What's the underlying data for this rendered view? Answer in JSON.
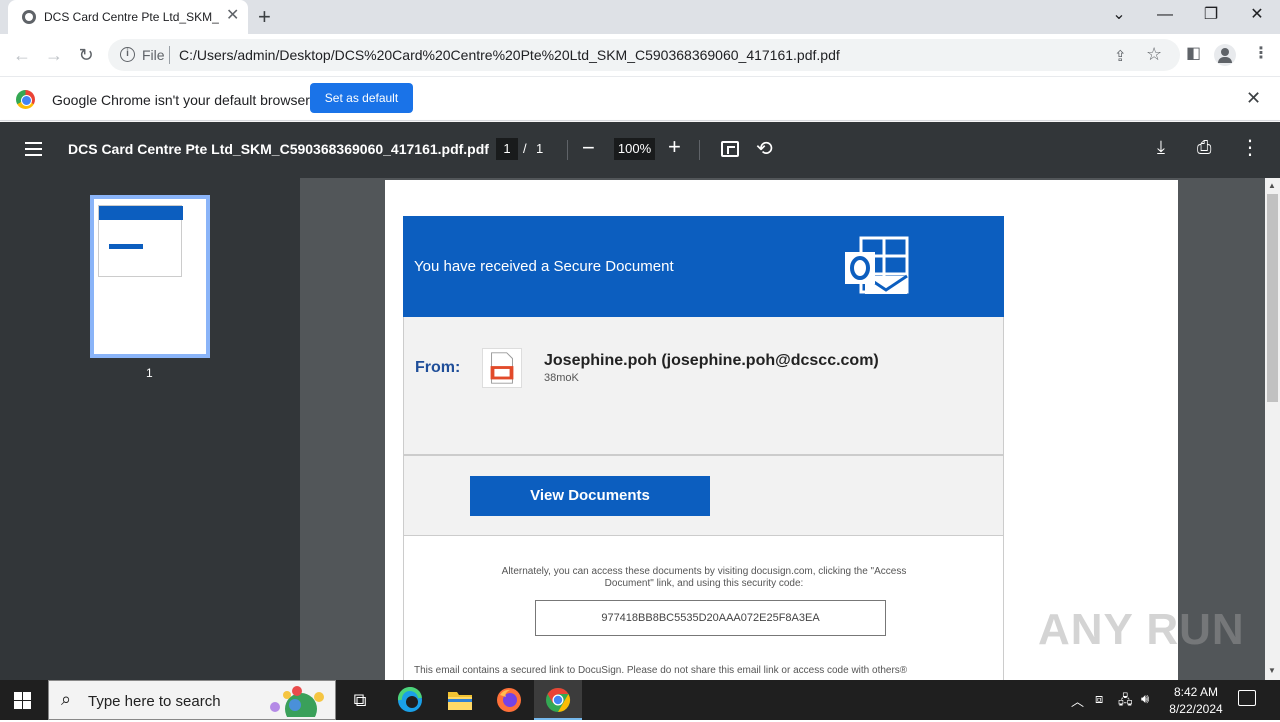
{
  "browser": {
    "tab_title": "DCS Card Centre Pte Ltd_SKM_C",
    "tab_close": "✕",
    "new_tab": "+",
    "url_scheme": "File",
    "url": "C:/Users/admin/Desktop/DCS%20Card%20Centre%20Pte%20Ltd_SKM_C590368369060_417161.pdf.pdf"
  },
  "infobar": {
    "message": "Google Chrome isn't your default browser",
    "button": "Set as default"
  },
  "pdf_toolbar": {
    "title": "DCS Card Centre Pte Ltd_SKM_C590368369060_417161.pdf.pdf",
    "page_current": "1",
    "page_sep": "/",
    "page_total": "1",
    "zoom": "100%"
  },
  "sidebar": {
    "thumb_label": "1"
  },
  "email": {
    "banner_text": "You have received a Secure Document",
    "from_label": "From:",
    "sender": "Josephine.poh (josephine.poh@dcscc.com)",
    "size": "38moK",
    "button": "View Documents",
    "alt_text": "Alternately, you can access these documents by visiting docusign.com, clicking the \"Access Document\" link, and using this security code:",
    "code": "977418BB8BC5535D20AAA072E25F8A3EA",
    "footnote": "This email contains a secured link to DocuSign. Please do not share this email link or access code with others®"
  },
  "watermark": "ANY RUN",
  "taskbar": {
    "search_placeholder": "Type here to search",
    "time": "8:42 AM",
    "date": "8/22/2024"
  },
  "colors": {
    "brand_blue": "#0c5ebf",
    "chrome_blue": "#1a73e8",
    "pdf_dark": "#323639"
  }
}
